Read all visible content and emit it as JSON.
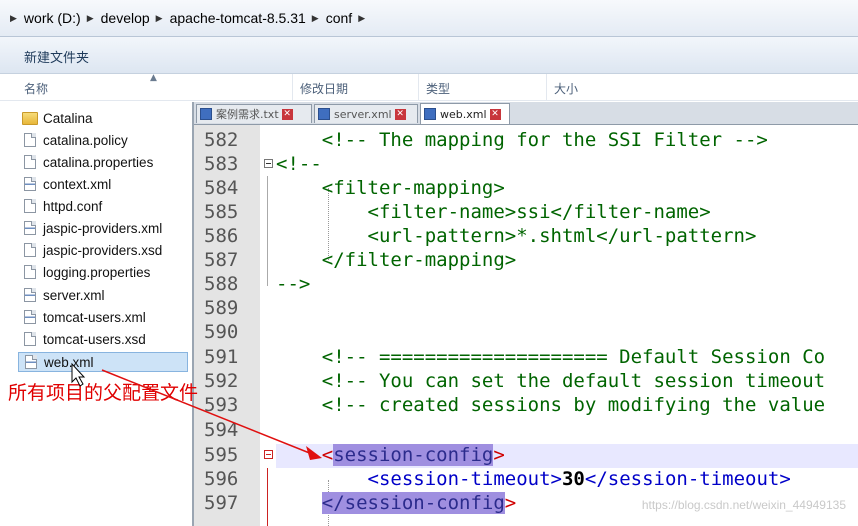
{
  "breadcrumb": [
    "work (D:)",
    "develop",
    "apache-tomcat-8.5.31",
    "conf"
  ],
  "toolbar": {
    "new_folder": "新建文件夹"
  },
  "columns": {
    "name": "名称",
    "modified": "修改日期",
    "type": "类型",
    "size": "大小"
  },
  "files": [
    {
      "name": "Catalina",
      "kind": "folder"
    },
    {
      "name": "catalina.policy",
      "kind": "file"
    },
    {
      "name": "catalina.properties",
      "kind": "file"
    },
    {
      "name": "context.xml",
      "kind": "xml"
    },
    {
      "name": "httpd.conf",
      "kind": "file"
    },
    {
      "name": "jaspic-providers.xml",
      "kind": "xml"
    },
    {
      "name": "jaspic-providers.xsd",
      "kind": "file"
    },
    {
      "name": "logging.properties",
      "kind": "file"
    },
    {
      "name": "server.xml",
      "kind": "xml"
    },
    {
      "name": "tomcat-users.xml",
      "kind": "xml"
    },
    {
      "name": "tomcat-users.xsd",
      "kind": "file"
    },
    {
      "name": "web.xml",
      "kind": "xml",
      "selected": true
    }
  ],
  "tabs": [
    {
      "label": "案例需求.txt",
      "active": false
    },
    {
      "label": "server.xml",
      "active": false
    },
    {
      "label": "web.xml",
      "active": true
    }
  ],
  "editor_lines": [
    {
      "num": "582",
      "text": "    <!-- The mapping for the SSI Filter -->"
    },
    {
      "num": "583",
      "text": "<!--"
    },
    {
      "num": "584",
      "text": "    <filter-mapping>"
    },
    {
      "num": "585",
      "text": "        <filter-name>ssi</filter-name>"
    },
    {
      "num": "586",
      "text": "        <url-pattern>*.shtml</url-pattern>"
    },
    {
      "num": "587",
      "text": "    </filter-mapping>"
    },
    {
      "num": "588",
      "text": "-->"
    },
    {
      "num": "589",
      "text": ""
    },
    {
      "num": "590",
      "text": ""
    },
    {
      "num": "591",
      "text": "    <!-- ==================== Default Session Co"
    },
    {
      "num": "592",
      "text": "    <!-- You can set the default session timeout"
    },
    {
      "num": "593",
      "text": "    <!-- created sessions by modifying the value"
    },
    {
      "num": "594",
      "text": ""
    },
    {
      "num": "595",
      "text": "    <session-config>"
    },
    {
      "num": "596",
      "text": "        <session-timeout>30</session-timeout>"
    },
    {
      "num": "597",
      "text": "    </session-config>"
    }
  ],
  "annotation": "所有项目的父配置文件",
  "watermark": "https://blog.csdn.net/weixin_44949135"
}
